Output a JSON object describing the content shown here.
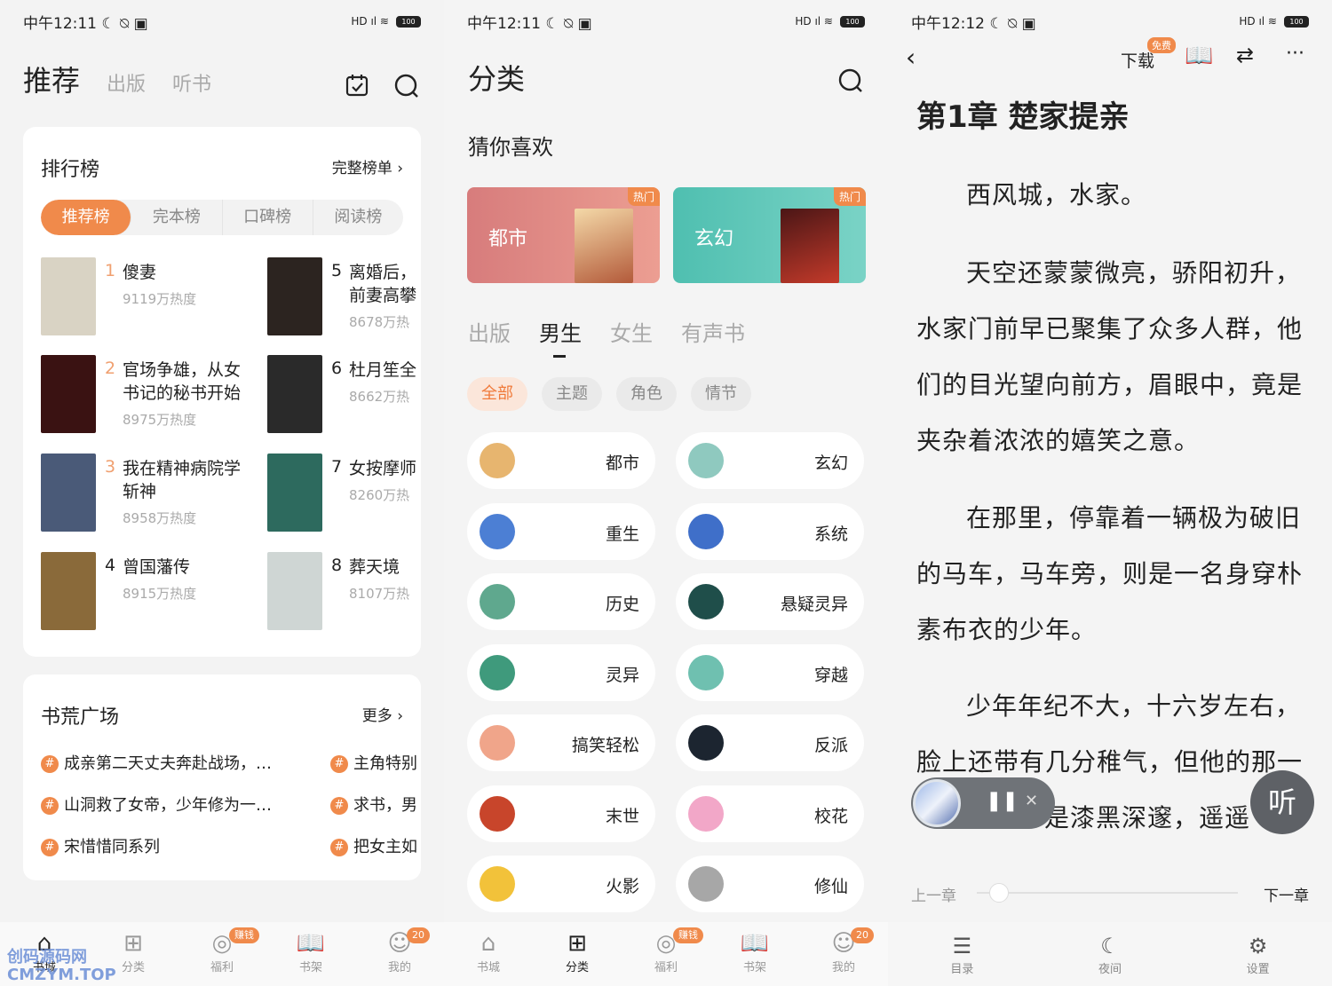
{
  "status": [
    {
      "time": "中午12:11",
      "icons": "☾ ⍉ ▣"
    },
    {
      "time": "中午12:11",
      "icons": "☾ ⍉ ▣"
    },
    {
      "time": "中午12:12",
      "icons": "☾ ⍉ ▣"
    }
  ],
  "status_right": "HD ıl  ≋",
  "battery": "100",
  "p1": {
    "tabs": [
      "推荐",
      "出版",
      "听书"
    ],
    "ranking": {
      "title": "排行榜",
      "more": "完整榜单 ›",
      "segments": [
        "推荐榜",
        "完本榜",
        "口碑榜",
        "阅读榜"
      ],
      "items": [
        {
          "num": "1",
          "title": "傻妻",
          "heat": "9119万热度",
          "color": "#d9d3c4"
        },
        {
          "num": "2",
          "title": "官场争雄，从女书记的秘书开始",
          "heat": "8975万热度",
          "color": "#3a1212"
        },
        {
          "num": "3",
          "title": "我在精神病院学斩神",
          "heat": "8958万热度",
          "color": "#4a5a78"
        },
        {
          "num": "4",
          "title": "曾国藩传",
          "heat": "8915万热度",
          "color": "#8a6a3a"
        },
        {
          "num": "5",
          "title": "离婚后，前妻高攀",
          "heat": "8678万热",
          "color": "#2c2420"
        },
        {
          "num": "6",
          "title": "杜月笙全",
          "heat": "8662万热",
          "color": "#2a2a2a"
        },
        {
          "num": "7",
          "title": "女按摩师",
          "heat": "8260万热",
          "color": "#2d6a5e"
        },
        {
          "num": "8",
          "title": "葬天境",
          "heat": "8107万热",
          "color": "#cfd6d4"
        }
      ]
    },
    "hot": {
      "title": "书荒广场",
      "more": "更多 ›",
      "items": [
        "成亲第二天丈夫奔赴战场，…",
        "山洞救了女帝，少年修为一…",
        "宋惜惜同系列",
        "主角特别",
        "求书，男",
        "把女主如"
      ]
    }
  },
  "nav": {
    "items": [
      "书城",
      "分类",
      "福利",
      "书架",
      "我的"
    ],
    "badge_fuli": "赚钱",
    "badge_me": "20"
  },
  "watermark": {
    "line1": "创码源码网",
    "line2": "CMZYM.TOP"
  },
  "p2": {
    "title": "分类",
    "guess": "猜你喜欢",
    "cards": [
      {
        "label": "都市",
        "hot": "热门",
        "bg": "#e08c85"
      },
      {
        "label": "玄幻",
        "hot": "热门",
        "bg": "#5fc7b6"
      }
    ],
    "tabs": [
      "出版",
      "男生",
      "女生",
      "有声书"
    ],
    "chips": [
      "全部",
      "主题",
      "角色",
      "情节"
    ],
    "cats": [
      {
        "l": "都市",
        "c": "#e7b56f"
      },
      {
        "l": "玄幻",
        "c": "#8fc9bf"
      },
      {
        "l": "重生",
        "c": "#4c7fd4"
      },
      {
        "l": "系统",
        "c": "#3f6fc9"
      },
      {
        "l": "历史",
        "c": "#5fa88e"
      },
      {
        "l": "悬疑灵异",
        "c": "#1f4e4a"
      },
      {
        "l": "灵异",
        "c": "#3f9a7c"
      },
      {
        "l": "穿越",
        "c": "#6fc0b0"
      },
      {
        "l": "搞笑轻松",
        "c": "#f0a58a"
      },
      {
        "l": "反派",
        "c": "#1c2530"
      },
      {
        "l": "末世",
        "c": "#c8452b"
      },
      {
        "l": "校花",
        "c": "#f2a7c8"
      },
      {
        "l": "火影",
        "c": "#f2c23a"
      },
      {
        "l": "修仙",
        "c": "#a7a7a7"
      }
    ]
  },
  "p3": {
    "download": "下载",
    "free": "免费",
    "more": "···",
    "chapter": "第1章 楚家提亲",
    "paras": [
      "西风城，水家。",
      "天空还蒙蒙微亮，骄阳初升，水家门前早已聚集了众多人群，他们的目光望向前方，眉眼中，竟是夹杂着浓浓的嬉笑之意。",
      "在那里，停靠着一辆极为破旧的马车，马车旁，则是一名身穿朴素布衣的少年。",
      "少年年纪不大，十六岁左右，脸上还带有几分稚气，但他的那一",
      "是漆黑深邃，遥遥"
    ],
    "prev": "上一章",
    "next": "下一章",
    "listen": "听",
    "bottom": [
      "目录",
      "夜间",
      "设置"
    ]
  }
}
